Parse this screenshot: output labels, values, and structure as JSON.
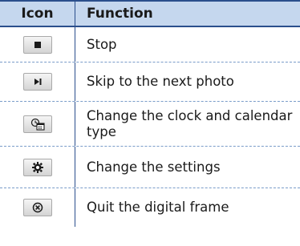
{
  "table": {
    "header": {
      "icon": "Icon",
      "function": "Function"
    },
    "rows": [
      {
        "icon": "stop-icon",
        "function": "Stop"
      },
      {
        "icon": "skip-next-icon",
        "function": "Skip to the next photo"
      },
      {
        "icon": "clock-calendar-icon",
        "function": "Change the clock and calendar type"
      },
      {
        "icon": "settings-gear-icon",
        "function": "Change the settings"
      },
      {
        "icon": "quit-close-icon",
        "function": "Quit the digital frame"
      }
    ]
  },
  "colors": {
    "header_background": "#c5d7ee",
    "rule": "#2b4f8c",
    "row_divider": "#7a9cc9"
  }
}
